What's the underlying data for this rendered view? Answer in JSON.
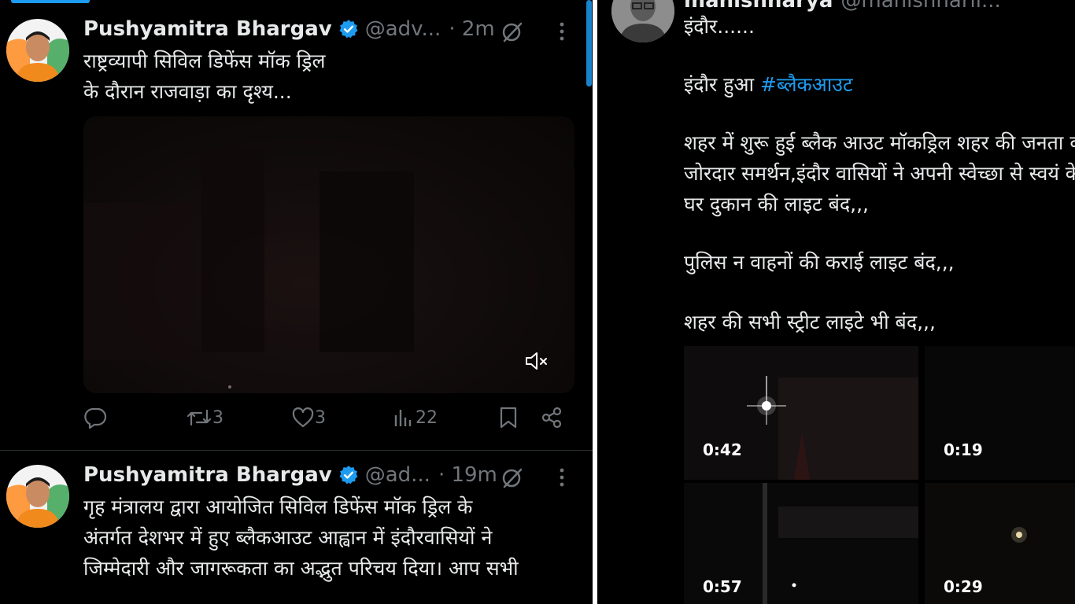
{
  "left_panel": {
    "tweets": [
      {
        "author_name": "Pushyamitra Bhargav",
        "handle": "@adv...",
        "time": "· 2m",
        "text_lines": [
          "राष्ट्रव्यापी सिविल डिफेंस मॉक ड्रिल",
          "के दौरान राजवाड़ा का दृश्य..."
        ],
        "media": {
          "type": "video",
          "muted": true
        },
        "actions": {
          "reposts": "3",
          "likes": "3",
          "views": "22"
        }
      },
      {
        "author_name": "Pushyamitra Bhargav",
        "handle": "@ad...",
        "time": "· 19m",
        "text_lines": [
          "गृह मंत्रालय द्वारा आयोजित सिविल डिफेंस मॉक ड्रिल के",
          "अंतर्गत देशभर में हुए ब्लैकआउट आह्वान में इंदौरवासियों ने",
          "जिम्मेदारी और जागरूकता का अद्भुत परिचय दिया। आप सभी"
        ]
      }
    ]
  },
  "right_panel": {
    "author_name": "manishnarya",
    "handle": "@manishnarii...",
    "lines": {
      "l1": "इंदौर......",
      "l2_prefix": "इंदौर हुआ ",
      "l2_hashtag": "#ब्लैकआउट",
      "l3": "शहर में शुरू हुई ब्लैक आउट मॉकड्रिल शहर की जनता का",
      "l4": "जोरदार समर्थन,इंदौर वासियों ने अपनी स्वेच्छा से स्वयं के",
      "l5": "घर दुकान की लाइट बंद,,,",
      "l6": "पुलिस न वाहनों की कराई लाइट बंद,,,",
      "l7": "शहर की सभी स्ट्रीट लाइटे भी बंद,,,"
    },
    "videos": [
      {
        "duration": "0:42"
      },
      {
        "duration": "0:19"
      },
      {
        "duration": "0:57"
      },
      {
        "duration": "0:29"
      }
    ]
  },
  "colors": {
    "accent": "#1d9bf0",
    "muted_text": "#71767b",
    "text": "#e7e9ea",
    "background": "#000000"
  },
  "icons": [
    "verified-badge-icon",
    "grok-icon",
    "more-icon",
    "mute-icon",
    "reply-icon",
    "repost-icon",
    "like-icon",
    "views-icon",
    "bookmark-icon",
    "share-icon"
  ]
}
